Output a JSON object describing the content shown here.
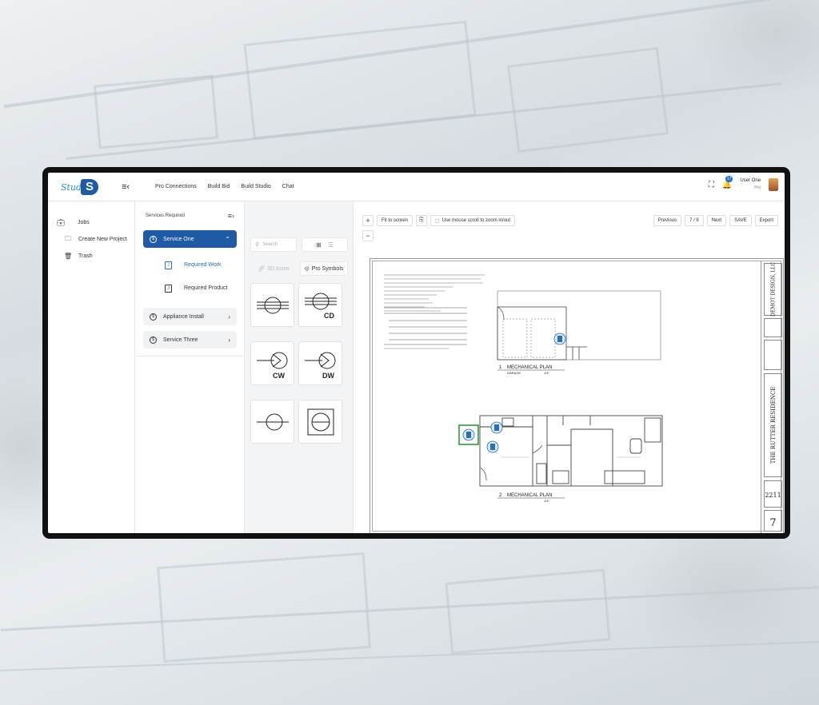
{
  "app": {
    "logo_text": "Studio",
    "logo_mono": "S"
  },
  "nav": [
    "Pro Connections",
    "Build Bid",
    "Build Studio",
    "Chat"
  ],
  "user": {
    "name": "User One",
    "role": "Pro",
    "notifications": "17"
  },
  "sidebar": {
    "items": [
      {
        "label": "Jobs",
        "icon": "briefcase-icon"
      },
      {
        "label": "Create New Project",
        "icon": "folder-plus-icon"
      },
      {
        "label": "Trash",
        "icon": "trash-icon"
      }
    ]
  },
  "services": {
    "header": "Services Required",
    "items": [
      {
        "num": "$",
        "label": "Service One",
        "active": true
      },
      {
        "num": "$",
        "label": "Appliance Install",
        "active": false
      },
      {
        "num": "$",
        "label": "Service Three",
        "active": false
      }
    ],
    "subitems": [
      "Required Work",
      "Required Product"
    ]
  },
  "symbols": {
    "search_placeholder": "Search",
    "tab_3d": "3D Icons",
    "tab_pro": "Pro Symbols",
    "items": [
      {
        "label": "",
        "icon": "washer-symbol-icon"
      },
      {
        "label": "CD",
        "icon": "dryer-symbol-icon"
      },
      {
        "label": "CW",
        "icon": "cold-water-symbol-icon"
      },
      {
        "label": "DW",
        "icon": "dishwasher-symbol-icon"
      },
      {
        "label": "",
        "icon": "disposal-symbol-icon"
      },
      {
        "label": "",
        "icon": "boxed-circle-symbol-icon"
      }
    ]
  },
  "toolbar": {
    "fit": "Fit to screen",
    "hint": "Use mouse scroll to zoom in/out",
    "previous": "Previous",
    "page": "7 / 8",
    "next": "Next",
    "save": "SAVE",
    "export": "Export"
  },
  "sheet": {
    "plan1_num": "1",
    "plan1_title": "MECHANICAL PLAN",
    "plan1_sub": "GARAGE",
    "plan1_scale": "1/4\"",
    "plan2_num": "2",
    "plan2_title": "MECHANICAL PLAN",
    "plan2_scale": "1/4\"",
    "firm": "DEMOT DESIGN, LLC",
    "project": "THE RUTTER RESIDENCE",
    "job_no": "2211",
    "sheet_no": "7"
  }
}
